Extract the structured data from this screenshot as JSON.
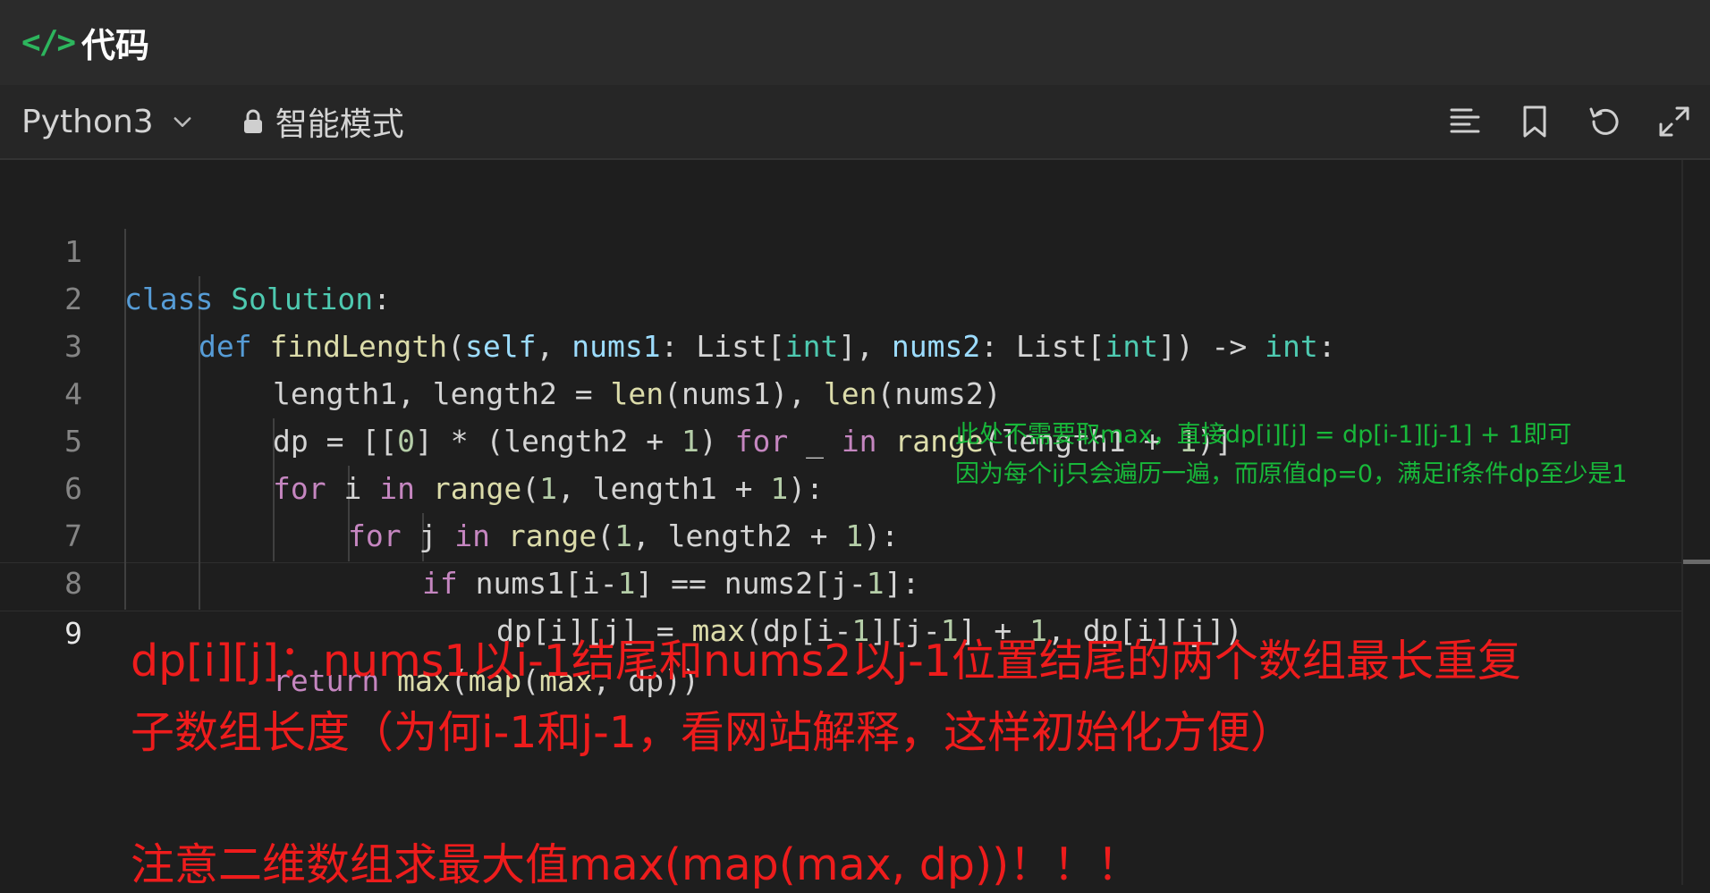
{
  "title_bar": {
    "icon": "</>",
    "title": "代码"
  },
  "toolbar": {
    "language": "Python3",
    "mode_label": "智能模式",
    "icons": [
      "format-icon",
      "bookmark-icon",
      "reset-icon",
      "fullscreen-icon"
    ]
  },
  "editor": {
    "lines": [
      {
        "number": "1"
      },
      {
        "number": "2"
      },
      {
        "number": "3"
      },
      {
        "number": "4"
      },
      {
        "number": "5"
      },
      {
        "number": "6"
      },
      {
        "number": "7"
      },
      {
        "number": "8"
      },
      {
        "number": "9"
      }
    ],
    "code": {
      "l1": [
        "class",
        " ",
        "Solution",
        ":"
      ],
      "l2": [
        "def",
        " ",
        "findLength",
        "(",
        "self",
        ", ",
        "nums1",
        ": List[",
        "int",
        "], ",
        "nums2",
        ": List[",
        "int",
        "]) -> ",
        "int",
        ":"
      ],
      "l3": [
        "length1, length2 = ",
        "len",
        "(nums1), ",
        "len",
        "(nums2)"
      ],
      "l4": [
        "dp = [[",
        "0",
        "] * (length2 + ",
        "1",
        ") ",
        "for",
        " _ ",
        "in",
        " ",
        "range",
        "(length1 + ",
        "1",
        ")]"
      ],
      "l5": [
        "for",
        " i ",
        "in",
        " ",
        "range",
        "(",
        "1",
        ", length1 + ",
        "1",
        "):"
      ],
      "l6": [
        "for",
        " j ",
        "in",
        " ",
        "range",
        "(",
        "1",
        ", length2 + ",
        "1",
        "):"
      ],
      "l7": [
        "if",
        " nums1[i-",
        "1",
        "] == nums2[j-",
        "1",
        "]:"
      ],
      "l8": [
        "dp[i][j] = ",
        "max",
        "(dp[i-",
        "1",
        "][j-",
        "1",
        "] + ",
        "1",
        ", dp[i][j])"
      ],
      "l9": [
        "return",
        " ",
        "max",
        "(",
        "map",
        "(",
        "max",
        ", dp))"
      ]
    }
  },
  "annotations": {
    "green_line1": "此处不需要取max，直接dp[i][j] = dp[i-1][j-1] + 1即可",
    "green_line2": "因为每个ij只会遍历一遍，而原值dp=0，满足if条件dp至少是1",
    "red_line1": "dp[i][j]：nums1以i-1结尾和nums2以j-1位置结尾的两个数组最长重复",
    "red_line2": "子数组长度（为何i-1和j-1，看网站解释，这样初始化方便）",
    "red_line3": "注意二维数组求最大值max(map(max, dp))！！！"
  },
  "colors": {
    "keyword": "#c586c0",
    "def_keyword": "#569cd6",
    "class_name": "#4ec9b0",
    "function": "#dcdcaa",
    "parameter": "#9cdcfe",
    "number": "#b5cea8",
    "annotation_green": "#18b83a",
    "annotation_red": "#ee1c1c"
  }
}
